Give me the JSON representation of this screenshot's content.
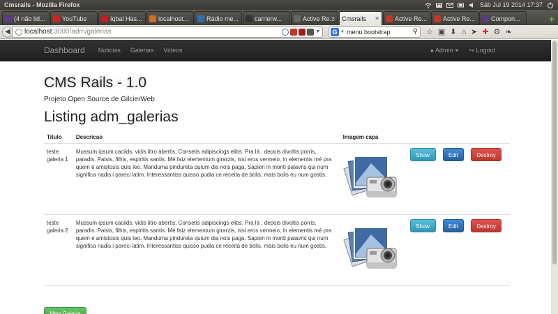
{
  "os": {
    "window_title": "Cmsrails - Mozilla Firefox",
    "datetime": "Sáb Jul 19 2014 17:37"
  },
  "tabs": [
    {
      "label": "(4 não lid...",
      "favicon_color": "#5b3a8c"
    },
    {
      "label": "YouTube",
      "favicon_color": "#d32323"
    },
    {
      "label": "Iqbal Has...",
      "favicon_color": "#c02020"
    },
    {
      "label": "localhost...",
      "favicon_color": "#c9702a"
    },
    {
      "label": "Rádio me...",
      "favicon_color": "#2e6fb0"
    },
    {
      "label": "carrierw...",
      "favicon_color": "#333333"
    },
    {
      "label": "Active Re...",
      "favicon_color": "#666666"
    },
    {
      "label": "Cmsrails",
      "favicon_color": "#ffffff",
      "active": true
    },
    {
      "label": "Active Re...",
      "favicon_color": "#c0392b"
    },
    {
      "label": "Active Re...",
      "favicon_color": "#c0392b"
    },
    {
      "label": "Compon...",
      "favicon_color": "#563d7c"
    }
  ],
  "url": {
    "host": "localhost",
    "path": ":3000/adm/galerias"
  },
  "search": {
    "engine_icon": "G",
    "value": "menu bootstrap"
  },
  "app": {
    "brand": "Dashboard",
    "nav": [
      "Noticias",
      "Galerias",
      "Videos"
    ],
    "admin_label": "Admin",
    "logout_label": "Logout"
  },
  "header": {
    "title": "CMS Rails - 1.0",
    "subtitle": "Projeto Open Source de GilcierWeb"
  },
  "listing": {
    "title": "Listing adm_galerias",
    "columns": [
      "Titulo",
      "Descricao",
      "Imagem capa"
    ],
    "rows": [
      {
        "titulo": "teste galeria 1",
        "descricao": "Mussum ipsum cacilds, vidis litro abertis. Consetis adipiscings elitis. Pra lá , depois divoltis porris, paradis. Paisis, filhis, espiritis santis. Mé faiz elementum girarzis, nisi eros vermeio, in elementis mé pra quem é amistosis quis leo. Manduma pindureta quium dia nois paga. Sapien in monti palavris qui num significa nadis i pareci latim. Interessantiss quisso pudia ce receita de bolis, mais bolis eu num gostis."
      },
      {
        "titulo": "teste galeria 2",
        "descricao": "Mussum ipsum cacilds, vidis litro abertis. Consetis adipiscings elitis. Pra lá , depois divoltis porris, paradis. Paisis, filhis, espiritis santis. Mé faiz elementum girarzis, nisi eros vermeio, in elementis mé pra quem é amistosis quis leo. Manduma pindureta quium dia nois paga. Sapien in monti palavris qui num significa nadis i pareci latim. Interessantiss quisso pudia ce receita de bolis, mais bolis eu num gostis."
      }
    ],
    "actions": {
      "show": "Show",
      "edit": "Edit",
      "destroy": "Destroy"
    },
    "new_button": "New Galeria"
  },
  "colors": {
    "show": "#5bc0de",
    "edit": "#3a87d1",
    "destroy": "#d9534f",
    "new": "#5cb85c"
  }
}
